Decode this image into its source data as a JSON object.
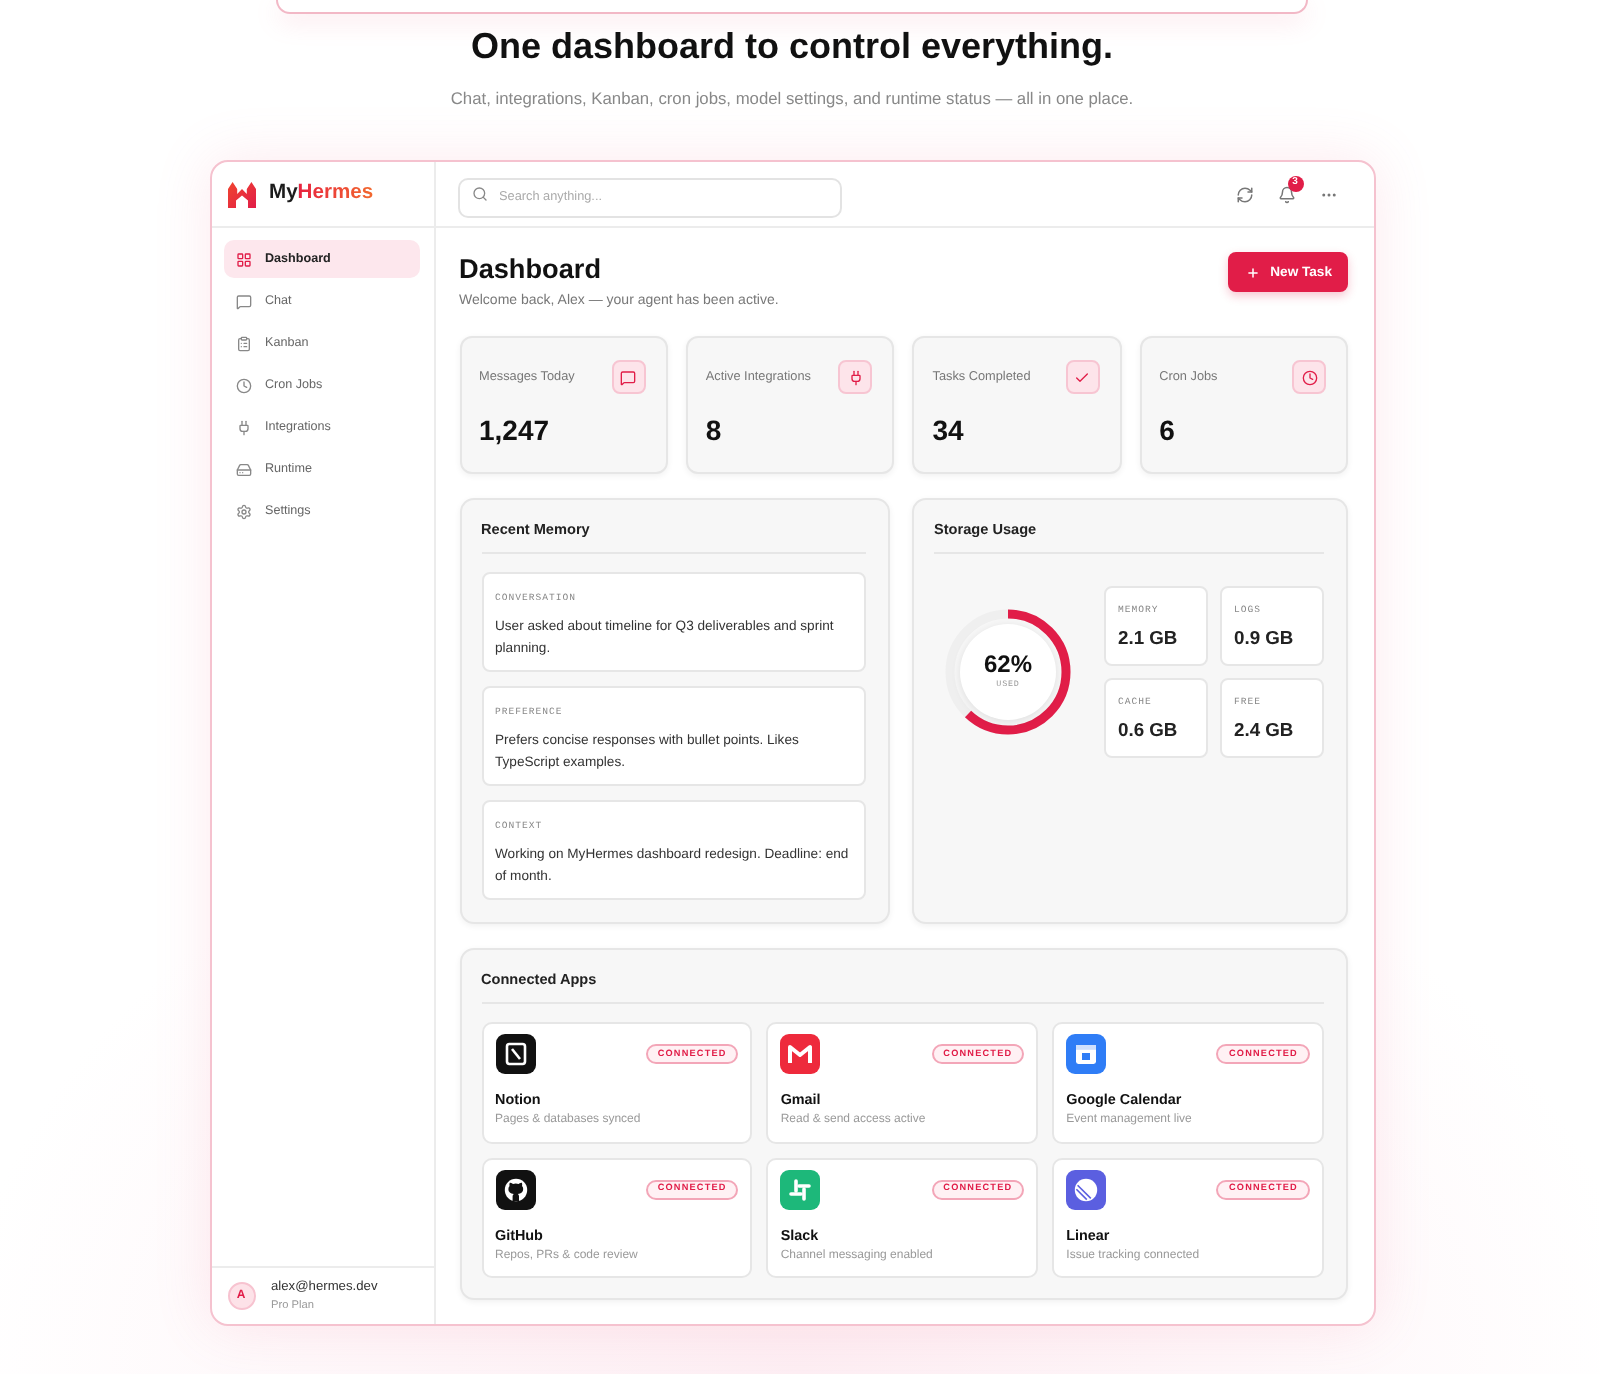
{
  "hero": {
    "title": "One dashboard to control everything.",
    "subtitle": "Chat, integrations, Kanban, cron jobs, model settings, and runtime status — all in one place."
  },
  "sidebar": {
    "logo": "MyHermes",
    "items": [
      {
        "label": "Dashboard",
        "selected": true
      },
      {
        "label": "Chat",
        "selected": false
      },
      {
        "label": "Kanban",
        "selected": false
      },
      {
        "label": "Cron Jobs",
        "selected": false
      },
      {
        "label": "Integrations",
        "selected": false
      },
      {
        "label": "Runtime",
        "selected": false
      },
      {
        "label": "Settings",
        "selected": false
      }
    ],
    "user": {
      "avatar": "A",
      "email": "alex@hermes.dev",
      "plan": "Pro Plan"
    }
  },
  "topbar": {
    "search": {
      "placeholder": "Search anything..."
    },
    "notification_count": "3"
  },
  "header": {
    "title": "Dashboard",
    "subtitle": "Welcome back, Alex — your agent has been active.",
    "button": "New Task"
  },
  "stats": [
    {
      "label": "Messages Today",
      "value": "1,247"
    },
    {
      "label": "Active Integrations",
      "value": "8"
    },
    {
      "label": "Tasks Completed",
      "value": "34"
    },
    {
      "label": "Cron Jobs",
      "value": "6"
    }
  ],
  "memory": {
    "title": "Recent Memory",
    "items": [
      {
        "tag": "CONVERSATION",
        "text": "User asked about timeline for Q3 deliverables and sprint planning."
      },
      {
        "tag": "PREFERENCE",
        "text": "Prefers concise responses with bullet points. Likes TypeScript examples."
      },
      {
        "tag": "CONTEXT",
        "text": "Working on MyHermes dashboard redesign. Deadline: end of month."
      }
    ]
  },
  "storage": {
    "title": "Storage Usage",
    "level": 0.62,
    "reading": "62%",
    "caption": "USED",
    "tiles": [
      {
        "label": "MEMORY",
        "value": "2.1 GB"
      },
      {
        "label": "LOGS",
        "value": "0.9 GB"
      },
      {
        "label": "CACHE",
        "value": "0.6 GB"
      },
      {
        "label": "FREE",
        "value": "2.4 GB"
      }
    ]
  },
  "apps": {
    "title": "Connected Apps",
    "items": [
      {
        "name": "Notion",
        "description": "Pages & databases synced",
        "status": "CONNECTED",
        "color": "#111111"
      },
      {
        "name": "Gmail",
        "description": "Read & send access active",
        "status": "CONNECTED",
        "color": "#ee2a3c"
      },
      {
        "name": "Google Calendar",
        "description": "Event management live",
        "status": "CONNECTED",
        "color": "#2f7df6"
      },
      {
        "name": "GitHub",
        "description": "Repos, PRs & code review",
        "status": "CONNECTED",
        "color": "#111111"
      },
      {
        "name": "Slack",
        "description": "Channel messaging enabled",
        "status": "CONNECTED",
        "color": "#1db87a"
      },
      {
        "name": "Linear",
        "description": "Issue tracking connected",
        "status": "CONNECTED",
        "color": "#5b5fe0"
      }
    ]
  }
}
